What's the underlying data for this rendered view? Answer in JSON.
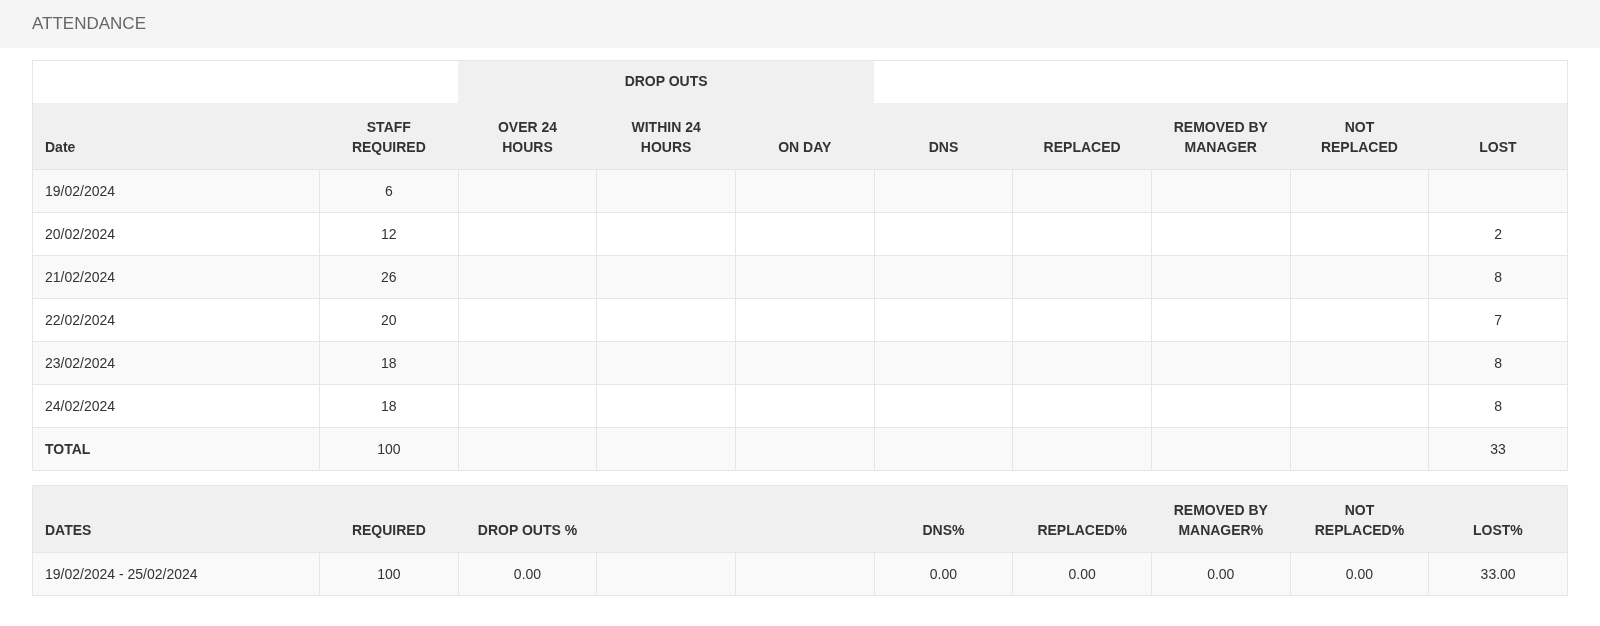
{
  "title": "ATTENDANCE",
  "attendance_table": {
    "group_header": "DROP OUTS",
    "columns": {
      "date": "Date",
      "staff_required": "STAFF\nREQUIRED",
      "over_24_hours": "OVER 24\nHOURS",
      "within_24_hours": "WITHIN 24\nHOURS",
      "on_day": "ON DAY",
      "dns": "DNS",
      "replaced": "REPLACED",
      "removed_by_manager": "REMOVED BY\nMANAGER",
      "not_replaced": "NOT\nREPLACED",
      "lost": "LOST"
    },
    "rows": [
      {
        "date": "19/02/2024",
        "staff_required": "6"
      },
      {
        "date": "20/02/2024",
        "staff_required": "12",
        "lost": "2"
      },
      {
        "date": "21/02/2024",
        "staff_required": "26",
        "lost": "8"
      },
      {
        "date": "22/02/2024",
        "staff_required": "20",
        "lost": "7"
      },
      {
        "date": "23/02/2024",
        "staff_required": "18",
        "lost": "8"
      },
      {
        "date": "24/02/2024",
        "staff_required": "18",
        "lost": "8"
      }
    ],
    "total": {
      "date": "TOTAL",
      "staff_required": "100",
      "lost": "33"
    }
  },
  "summary_table": {
    "columns": {
      "dates": "DATES",
      "required": "REQUIRED",
      "drop_outs_pct": "DROP OUTS %",
      "dns_pct": "DNS%",
      "replaced_pct": "REPLACED%",
      "removed_by_manager_pct": "REMOVED BY\nMANAGER%",
      "not_replaced_pct": "NOT\nREPLACED%",
      "lost_pct": "LOST%"
    },
    "rows": [
      {
        "dates": "19/02/2024 - 25/02/2024",
        "required": "100",
        "drop_outs_pct": "0.00",
        "dns_pct": "0.00",
        "replaced_pct": "0.00",
        "removed_by_manager_pct": "0.00",
        "not_replaced_pct": "0.00",
        "lost_pct": "33.00"
      }
    ]
  }
}
